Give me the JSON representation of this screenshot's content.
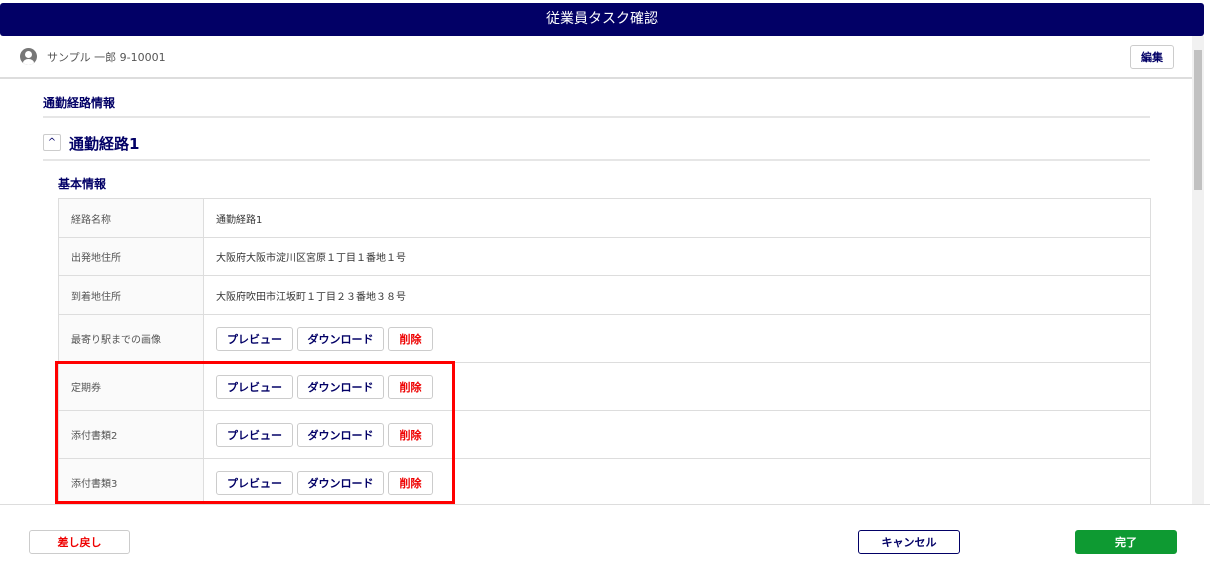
{
  "header": {
    "title": "従業員タスク確認"
  },
  "user": {
    "name": "サンプル 一郎 9-10001",
    "edit_label": "編集"
  },
  "section": {
    "title": "通勤経路情報",
    "route_title": "通勤経路1",
    "basic_title": "基本情報"
  },
  "buttons": {
    "preview": "プレビュー",
    "download": "ダウンロード",
    "delete": "削除"
  },
  "rows": [
    {
      "label": "経路名称",
      "value": "通勤経路1"
    },
    {
      "label": "出発地住所",
      "value": "大阪府大阪市淀川区宮原１丁目１番地１号"
    },
    {
      "label": "到着地住所",
      "value": "大阪府吹田市江坂町１丁目２３番地３８号"
    },
    {
      "label": "最寄り駅までの画像"
    },
    {
      "label": "定期券"
    },
    {
      "label": "添付書類2"
    },
    {
      "label": "添付書類3"
    }
  ],
  "footer": {
    "send_back": "差し戻し",
    "cancel": "キャンセル",
    "complete": "完了"
  }
}
